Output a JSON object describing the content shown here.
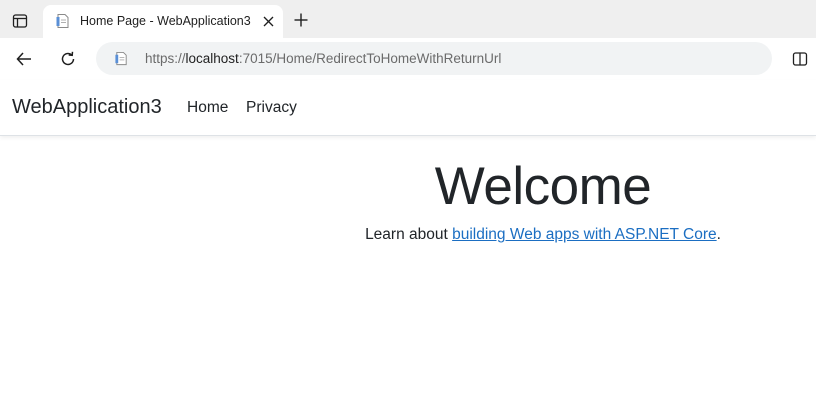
{
  "browser": {
    "tab": {
      "title": "Home Page - WebApplication3",
      "close_glyph": "✕",
      "favicon": "page-icon"
    },
    "new_tab_glyph": "+",
    "address": {
      "scheme": "https://",
      "host": "localhost",
      "rest": ":7015/Home/RedirectToHomeWithReturnUrl"
    },
    "icons": {
      "tab_actions": "tab-actions-icon",
      "back": "back-arrow-icon",
      "refresh": "refresh-icon",
      "split_screen": "split-screen-icon"
    }
  },
  "site": {
    "brand": "WebApplication3",
    "nav": [
      {
        "label": "Home"
      },
      {
        "label": "Privacy"
      }
    ]
  },
  "main": {
    "heading": "Welcome",
    "lead_prefix": "Learn about ",
    "link_text": "building Web apps with ASP.NET Core",
    "lead_suffix": "."
  },
  "colors": {
    "link": "#1b6ec2",
    "text": "#212529",
    "tabstrip": "#efefef",
    "address_bar": "#f1f3f4"
  }
}
